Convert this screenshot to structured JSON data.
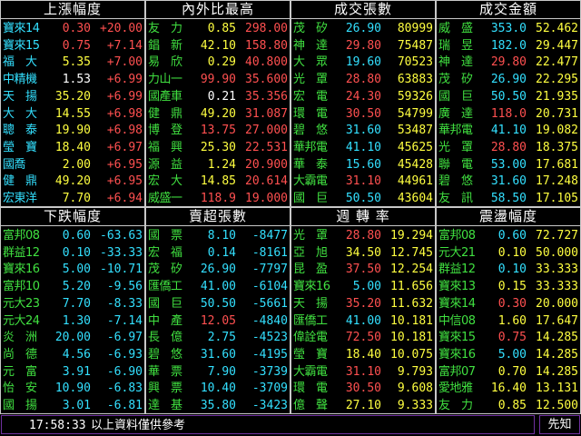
{
  "colors": {
    "name": "#33e0ff",
    "name_green": "#40e040",
    "price_red": "#ff5050",
    "value_yellow": "#ffff40",
    "value_green": "#40e040",
    "value_white": "#ffffff",
    "value_cyan": "#33e0ff",
    "border": "#c8c8c8",
    "footer_border": "#7030a0"
  },
  "panels": [
    {
      "title": "上漲幅度",
      "rows": [
        {
          "name": "寶來14",
          "price": "0.30",
          "value": "+20.00",
          "pc": "price_red",
          "vc": "price_red",
          "nc": "name"
        },
        {
          "name": "寶來15",
          "price": "0.75",
          "value": "+7.14",
          "pc": "price_red",
          "vc": "price_red",
          "nc": "name"
        },
        {
          "name": "福　大",
          "price": "5.35",
          "value": "+7.00",
          "pc": "value_yellow",
          "vc": "price_red",
          "nc": "name"
        },
        {
          "name": "中精機",
          "price": "1.53",
          "value": "+6.99",
          "pc": "value_white",
          "vc": "price_red",
          "nc": "name"
        },
        {
          "name": "天　揚",
          "price": "35.20",
          "value": "+6.99",
          "pc": "value_yellow",
          "vc": "price_red",
          "nc": "name"
        },
        {
          "name": "大　大",
          "price": "14.55",
          "value": "+6.98",
          "pc": "value_yellow",
          "vc": "price_red",
          "nc": "name"
        },
        {
          "name": "聰　泰",
          "price": "19.90",
          "value": "+6.98",
          "pc": "value_yellow",
          "vc": "price_red",
          "nc": "name"
        },
        {
          "name": "瑩　寶",
          "price": "18.40",
          "value": "+6.97",
          "pc": "value_yellow",
          "vc": "price_red",
          "nc": "name"
        },
        {
          "name": "國喬",
          "price": "2.00",
          "value": "+6.95",
          "pc": "value_yellow",
          "vc": "price_red",
          "nc": "name"
        },
        {
          "name": "健　鼎",
          "price": "49.20",
          "value": "+6.95",
          "pc": "value_yellow",
          "vc": "price_red",
          "nc": "name"
        },
        {
          "name": "宏東洋",
          "price": "7.70",
          "value": "+6.94",
          "pc": "value_yellow",
          "vc": "price_red",
          "nc": "name"
        }
      ]
    },
    {
      "title": "內外比最高",
      "rows": [
        {
          "name": "友　力",
          "price": "0.85",
          "value": "298.00",
          "pc": "value_yellow",
          "vc": "price_red",
          "nc": "name_green"
        },
        {
          "name": "錩　新",
          "price": "42.10",
          "value": "158.80",
          "pc": "value_yellow",
          "vc": "price_red",
          "nc": "name_green"
        },
        {
          "name": "易　欣",
          "price": "0.29",
          "value": "40.800",
          "pc": "value_yellow",
          "vc": "price_red",
          "nc": "name_green"
        },
        {
          "name": "力山一",
          "price": "99.90",
          "value": "35.600",
          "pc": "price_red",
          "vc": "price_red",
          "nc": "name_green"
        },
        {
          "name": "國產車",
          "price": "0.21",
          "value": "35.356",
          "pc": "value_white",
          "vc": "price_red",
          "nc": "name_green"
        },
        {
          "name": "健　鼎",
          "price": "49.20",
          "value": "31.087",
          "pc": "value_yellow",
          "vc": "price_red",
          "nc": "name_green"
        },
        {
          "name": "博　登",
          "price": "13.75",
          "value": "27.000",
          "pc": "price_red",
          "vc": "price_red",
          "nc": "name_green"
        },
        {
          "name": "福　興",
          "price": "25.30",
          "value": "22.531",
          "pc": "value_yellow",
          "vc": "price_red",
          "nc": "name_green"
        },
        {
          "name": "源　益",
          "price": "1.24",
          "value": "20.900",
          "pc": "value_yellow",
          "vc": "price_red",
          "nc": "name_green"
        },
        {
          "name": "宏　大",
          "price": "14.85",
          "value": "20.614",
          "pc": "value_yellow",
          "vc": "price_red",
          "nc": "name_green"
        },
        {
          "name": "威盛一",
          "price": "118.9",
          "value": "19.000",
          "pc": "price_red",
          "vc": "price_red",
          "nc": "name_green"
        }
      ]
    },
    {
      "title": "成交張數",
      "rows": [
        {
          "name": "茂　矽",
          "price": "26.90",
          "value": "80999",
          "pc": "value_cyan",
          "vc": "value_yellow",
          "nc": "name_green"
        },
        {
          "name": "神　達",
          "price": "29.80",
          "value": "75487",
          "pc": "price_red",
          "vc": "value_yellow",
          "nc": "name_green"
        },
        {
          "name": "大　眾",
          "price": "19.60",
          "value": "70523",
          "pc": "value_cyan",
          "vc": "value_yellow",
          "nc": "name_green"
        },
        {
          "name": "光　罩",
          "price": "28.80",
          "value": "63883",
          "pc": "price_red",
          "vc": "value_yellow",
          "nc": "name_green"
        },
        {
          "name": "宏　電",
          "price": "24.30",
          "value": "59326",
          "pc": "price_red",
          "vc": "value_yellow",
          "nc": "name_green"
        },
        {
          "name": "環　電",
          "price": "30.50",
          "value": "54799",
          "pc": "price_red",
          "vc": "value_yellow",
          "nc": "name_green"
        },
        {
          "name": "碧　悠",
          "price": "31.60",
          "value": "53487",
          "pc": "value_cyan",
          "vc": "value_yellow",
          "nc": "name_green"
        },
        {
          "name": "華邦電",
          "price": "41.10",
          "value": "45625",
          "pc": "value_cyan",
          "vc": "value_yellow",
          "nc": "name_green"
        },
        {
          "name": "華　泰",
          "price": "15.60",
          "value": "45428",
          "pc": "value_cyan",
          "vc": "value_yellow",
          "nc": "name_green"
        },
        {
          "name": "大霸電",
          "price": "31.10",
          "value": "44961",
          "pc": "price_red",
          "vc": "value_yellow",
          "nc": "name_green"
        },
        {
          "name": "國　巨",
          "price": "50.50",
          "value": "43604",
          "pc": "value_cyan",
          "vc": "value_yellow",
          "nc": "name_green"
        }
      ]
    },
    {
      "title": "成交金額",
      "rows": [
        {
          "name": "威　盛",
          "price": "353.0",
          "value": "52.462",
          "pc": "value_cyan",
          "vc": "value_yellow",
          "nc": "name_green"
        },
        {
          "name": "瑞　昱",
          "price": "182.0",
          "value": "29.447",
          "pc": "value_cyan",
          "vc": "value_yellow",
          "nc": "name_green"
        },
        {
          "name": "神　達",
          "price": "29.80",
          "value": "22.477",
          "pc": "price_red",
          "vc": "value_yellow",
          "nc": "name_green"
        },
        {
          "name": "茂　矽",
          "price": "26.90",
          "value": "22.295",
          "pc": "value_cyan",
          "vc": "value_yellow",
          "nc": "name_green"
        },
        {
          "name": "國　巨",
          "price": "50.50",
          "value": "21.935",
          "pc": "value_cyan",
          "vc": "value_yellow",
          "nc": "name_green"
        },
        {
          "name": "廣　達",
          "price": "118.0",
          "value": "20.731",
          "pc": "price_red",
          "vc": "value_yellow",
          "nc": "name_green"
        },
        {
          "name": "華邦電",
          "price": "41.10",
          "value": "19.082",
          "pc": "value_cyan",
          "vc": "value_yellow",
          "nc": "name_green"
        },
        {
          "name": "光　罩",
          "price": "28.80",
          "value": "18.375",
          "pc": "price_red",
          "vc": "value_yellow",
          "nc": "name_green"
        },
        {
          "name": "聯　電",
          "price": "53.00",
          "value": "17.681",
          "pc": "value_cyan",
          "vc": "value_yellow",
          "nc": "name_green"
        },
        {
          "name": "碧　悠",
          "price": "31.60",
          "value": "17.248",
          "pc": "value_cyan",
          "vc": "value_yellow",
          "nc": "name_green"
        },
        {
          "name": "友　訊",
          "price": "58.50",
          "value": "17.105",
          "pc": "value_cyan",
          "vc": "value_yellow",
          "nc": "name_green"
        }
      ]
    },
    {
      "title": "下跌幅度",
      "rows": [
        {
          "name": "富邦08",
          "price": "0.60",
          "value": "-63.63",
          "pc": "value_cyan",
          "vc": "value_cyan",
          "nc": "name_green"
        },
        {
          "name": "群益12",
          "price": "0.10",
          "value": "-33.33",
          "pc": "value_cyan",
          "vc": "value_cyan",
          "nc": "name_green"
        },
        {
          "name": "寶來16",
          "price": "5.00",
          "value": "-10.71",
          "pc": "value_cyan",
          "vc": "value_cyan",
          "nc": "name_green"
        },
        {
          "name": "富邦10",
          "price": "5.20",
          "value": "-9.56",
          "pc": "value_cyan",
          "vc": "value_cyan",
          "nc": "name_green"
        },
        {
          "name": "元大23",
          "price": "7.70",
          "value": "-8.33",
          "pc": "value_cyan",
          "vc": "value_cyan",
          "nc": "name_green"
        },
        {
          "name": "元大24",
          "price": "1.30",
          "value": "-7.14",
          "pc": "value_cyan",
          "vc": "value_cyan",
          "nc": "name_green"
        },
        {
          "name": "炎　洲",
          "price": "20.00",
          "value": "-6.97",
          "pc": "value_cyan",
          "vc": "value_cyan",
          "nc": "name_green"
        },
        {
          "name": "尚　德",
          "price": "4.56",
          "value": "-6.93",
          "pc": "value_cyan",
          "vc": "value_cyan",
          "nc": "name_green"
        },
        {
          "name": "元　富",
          "price": "3.91",
          "value": "-6.90",
          "pc": "value_cyan",
          "vc": "value_cyan",
          "nc": "name_green"
        },
        {
          "name": "怡　安",
          "price": "10.90",
          "value": "-6.83",
          "pc": "value_cyan",
          "vc": "value_cyan",
          "nc": "name_green"
        },
        {
          "name": "國　揚",
          "price": "3.01",
          "value": "-6.81",
          "pc": "value_cyan",
          "vc": "value_cyan",
          "nc": "name_green"
        }
      ]
    },
    {
      "title": "賣超張數",
      "rows": [
        {
          "name": "國　票",
          "price": "8.10",
          "value": "-8477",
          "pc": "value_cyan",
          "vc": "value_cyan",
          "nc": "name_green"
        },
        {
          "name": "宏　福",
          "price": "0.14",
          "value": "-8161",
          "pc": "value_cyan",
          "vc": "value_cyan",
          "nc": "name_green"
        },
        {
          "name": "茂　矽",
          "price": "26.90",
          "value": "-7797",
          "pc": "value_cyan",
          "vc": "value_cyan",
          "nc": "name_green"
        },
        {
          "name": "匯僑工",
          "price": "41.00",
          "value": "-6104",
          "pc": "value_cyan",
          "vc": "value_cyan",
          "nc": "name_green"
        },
        {
          "name": "國　巨",
          "price": "50.50",
          "value": "-5661",
          "pc": "value_cyan",
          "vc": "value_cyan",
          "nc": "name_green"
        },
        {
          "name": "中　產",
          "price": "12.05",
          "value": "-4840",
          "pc": "price_red",
          "vc": "value_cyan",
          "nc": "name_green"
        },
        {
          "name": "長　億",
          "price": "2.75",
          "value": "-4523",
          "pc": "value_cyan",
          "vc": "value_cyan",
          "nc": "name_green"
        },
        {
          "name": "碧　悠",
          "price": "31.60",
          "value": "-4195",
          "pc": "value_cyan",
          "vc": "value_cyan",
          "nc": "name_green"
        },
        {
          "name": "華　票",
          "price": "7.90",
          "value": "-3739",
          "pc": "value_cyan",
          "vc": "value_cyan",
          "nc": "name_green"
        },
        {
          "name": "興　票",
          "price": "10.40",
          "value": "-3709",
          "pc": "value_cyan",
          "vc": "value_cyan",
          "nc": "name_green"
        },
        {
          "name": "達　基",
          "price": "35.80",
          "value": "-3423",
          "pc": "value_cyan",
          "vc": "value_cyan",
          "nc": "name_green"
        }
      ]
    },
    {
      "title": "週 轉 率",
      "rows": [
        {
          "name": "光　罩",
          "price": "28.80",
          "value": "19.294",
          "pc": "price_red",
          "vc": "value_yellow",
          "nc": "name_green"
        },
        {
          "name": "亞　旭",
          "price": "34.50",
          "value": "12.745",
          "pc": "value_yellow",
          "vc": "value_yellow",
          "nc": "name_green"
        },
        {
          "name": "昆　盈",
          "price": "37.50",
          "value": "12.254",
          "pc": "price_red",
          "vc": "value_yellow",
          "nc": "name_green"
        },
        {
          "name": "寶來16",
          "price": "5.00",
          "value": "11.656",
          "pc": "value_cyan",
          "vc": "value_yellow",
          "nc": "name_green"
        },
        {
          "name": "天　揚",
          "price": "35.20",
          "value": "11.632",
          "pc": "price_red",
          "vc": "value_yellow",
          "nc": "name_green"
        },
        {
          "name": "匯僑工",
          "price": "41.00",
          "value": "10.181",
          "pc": "value_cyan",
          "vc": "value_yellow",
          "nc": "name_green"
        },
        {
          "name": "偉詮電",
          "price": "72.50",
          "value": "10.181",
          "pc": "price_red",
          "vc": "value_yellow",
          "nc": "name_green"
        },
        {
          "name": "瑩　寶",
          "price": "18.40",
          "value": "10.075",
          "pc": "value_yellow",
          "vc": "value_yellow",
          "nc": "name_green"
        },
        {
          "name": "大霸電",
          "price": "31.10",
          "value": "9.793",
          "pc": "price_red",
          "vc": "value_yellow",
          "nc": "name_green"
        },
        {
          "name": "環　電",
          "price": "30.50",
          "value": "9.608",
          "pc": "price_red",
          "vc": "value_yellow",
          "nc": "name_green"
        },
        {
          "name": "億　聲",
          "price": "27.10",
          "value": "9.333",
          "pc": "value_yellow",
          "vc": "value_yellow",
          "nc": "name_green"
        }
      ]
    },
    {
      "title": "震盪幅度",
      "rows": [
        {
          "name": "富邦08",
          "price": "0.60",
          "value": "72.727",
          "pc": "value_cyan",
          "vc": "value_yellow",
          "nc": "name_green"
        },
        {
          "name": "元大21",
          "price": "0.10",
          "value": "50.000",
          "pc": "value_yellow",
          "vc": "value_yellow",
          "nc": "name_green"
        },
        {
          "name": "群益12",
          "price": "0.10",
          "value": "33.333",
          "pc": "value_cyan",
          "vc": "value_yellow",
          "nc": "name_green"
        },
        {
          "name": "寶來13",
          "price": "0.15",
          "value": "33.333",
          "pc": "value_yellow",
          "vc": "value_yellow",
          "nc": "name_green"
        },
        {
          "name": "寶來14",
          "price": "0.30",
          "value": "20.000",
          "pc": "price_red",
          "vc": "value_yellow",
          "nc": "name_green"
        },
        {
          "name": "中信08",
          "price": "1.60",
          "value": "17.647",
          "pc": "value_yellow",
          "vc": "value_yellow",
          "nc": "name_green"
        },
        {
          "name": "寶來15",
          "price": "0.75",
          "value": "14.285",
          "pc": "price_red",
          "vc": "value_yellow",
          "nc": "name_green"
        },
        {
          "name": "寶來16",
          "price": "5.00",
          "value": "14.285",
          "pc": "value_cyan",
          "vc": "value_yellow",
          "nc": "name_green"
        },
        {
          "name": "富邦07",
          "price": "0.70",
          "value": "14.285",
          "pc": "value_yellow",
          "vc": "value_yellow",
          "nc": "name_green"
        },
        {
          "name": "愛地雅",
          "price": "16.40",
          "value": "13.131",
          "pc": "value_yellow",
          "vc": "value_yellow",
          "nc": "name_green"
        },
        {
          "name": "友　力",
          "price": "0.85",
          "value": "12.500",
          "pc": "value_yellow",
          "vc": "value_yellow",
          "nc": "name_green"
        }
      ]
    }
  ],
  "footer": {
    "time": "17:58:33",
    "message": "以上資料僅供參考",
    "right_label": "先知"
  }
}
